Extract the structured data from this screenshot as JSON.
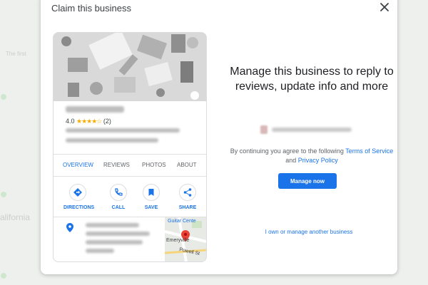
{
  "background": {
    "texts": [
      "The first",
      "alifornia"
    ]
  },
  "dialog": {
    "title": "Claim this business",
    "close_icon": "close-icon"
  },
  "business_card": {
    "rating_value": "4.0",
    "stars": "★★★★☆",
    "review_count": "(2)",
    "tabs": [
      "OVERVIEW",
      "REVIEWS",
      "PHOTOS",
      "ABOUT"
    ],
    "actions": [
      {
        "label": "DIRECTIONS",
        "icon": "directions-icon"
      },
      {
        "label": "CALL",
        "icon": "phone-icon"
      },
      {
        "label": "SAVE",
        "icon": "bookmark-icon"
      },
      {
        "label": "SHARE",
        "icon": "share-icon"
      }
    ],
    "map_labels": [
      "Guitar Cente",
      "Emeryville",
      "Powell St"
    ]
  },
  "panel": {
    "headline": "Manage this business to reply to reviews, update info and more",
    "consent_text": "By continuing you agree to the following",
    "terms_link": "Terms of Service",
    "and_text": "and",
    "privacy_link": "Privacy Policy",
    "manage_button": "Manage now",
    "other_business_link": "I own or manage another business"
  },
  "colors": {
    "accent": "#1a73e8",
    "star": "#f9ab00",
    "map_pin": "#ea4335"
  }
}
